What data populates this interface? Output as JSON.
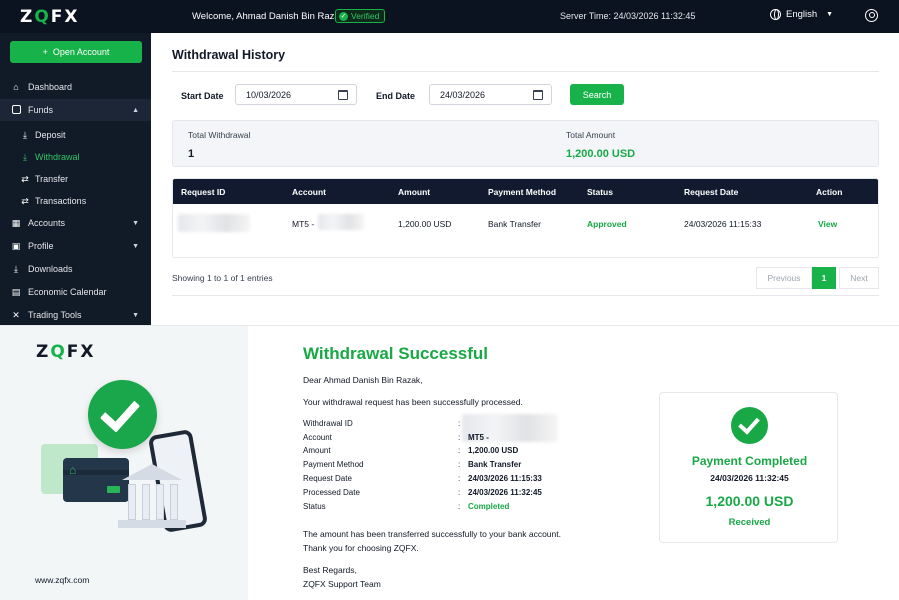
{
  "topbar": {
    "logo_pre": "Z",
    "logo_q": "Q",
    "logo_post": "FX",
    "welcome": "Welcome, Ahmad Danish Bin Razak",
    "verified": "Verified",
    "server_time": "Server Time:  24/03/2026 11:32:45",
    "language": "English"
  },
  "sidebar": {
    "open_account": "Open Account",
    "items": {
      "dashboard": "Dashboard",
      "funds": "Funds",
      "deposit": "Deposit",
      "withdrawal": "Withdrawal",
      "transfer": "Transfer",
      "transactions": "Transactions",
      "accounts": "Accounts",
      "profile": "Profile",
      "downloads": "Downloads",
      "economic_calendar": "Economic Calendar",
      "trading_tools": "Trading Tools"
    }
  },
  "main": {
    "title": "Withdrawal History",
    "start_label": "Start Date",
    "start_value": "10/03/2026",
    "end_label": "End Date",
    "end_value": "24/03/2026",
    "search": "Search",
    "summary": {
      "total_withdrawal_label": "Total Withdrawal",
      "total_withdrawal_value": "1",
      "total_amount_label": "Total Amount",
      "total_amount_value": "1,200.00 USD"
    },
    "table": {
      "headers": [
        "Request ID",
        "Account",
        "Amount",
        "Payment Method",
        "Status",
        "Request Date",
        "Action"
      ],
      "row": {
        "account": "MT5 -",
        "amount": "1,200.00 USD",
        "method": "Bank Transfer",
        "status": "Approved",
        "date": "24/03/2026 11:15:33",
        "action": "View"
      }
    },
    "showing": "Showing 1 to 1 of 1 entries",
    "pager": {
      "prev": "Previous",
      "page": "1",
      "next": "Next"
    }
  },
  "email": {
    "logo_pre": "Z",
    "logo_q": "Q",
    "logo_post": "FX",
    "title": "Withdrawal Successful",
    "greeting": "Dear Ahmad Danish Bin Razak,",
    "intro": "Your withdrawal request has been successfully processed.",
    "details": {
      "withdrawal_id_label": "Withdrawal ID",
      "account_label": "Account",
      "account_value": "MT5 -",
      "amount_label": "Amount",
      "amount_value": "1,200.00 USD",
      "method_label": "Payment Method",
      "method_value": "Bank Transfer",
      "request_label": "Request Date",
      "request_value": "24/03/2026 11:15:33",
      "processed_label": "Processed Date",
      "processed_value": "24/03/2026 11:32:45",
      "status_label": "Status",
      "status_value": "Completed",
      "colon": ":"
    },
    "note1": "The amount has been transferred successfully to your bank account.",
    "note2": "Thank you for choosing ZQFX.",
    "regards": "Best Regards,",
    "team": "ZQFX Support Team",
    "website": "www.zqfx.com",
    "card": {
      "title": "Payment Completed",
      "date": "24/03/2026 11:32:45",
      "amount": "1,200.00 USD",
      "received": "Received"
    }
  },
  "colors": {
    "brand_green": "#18b24b",
    "navy": "#111a27"
  }
}
